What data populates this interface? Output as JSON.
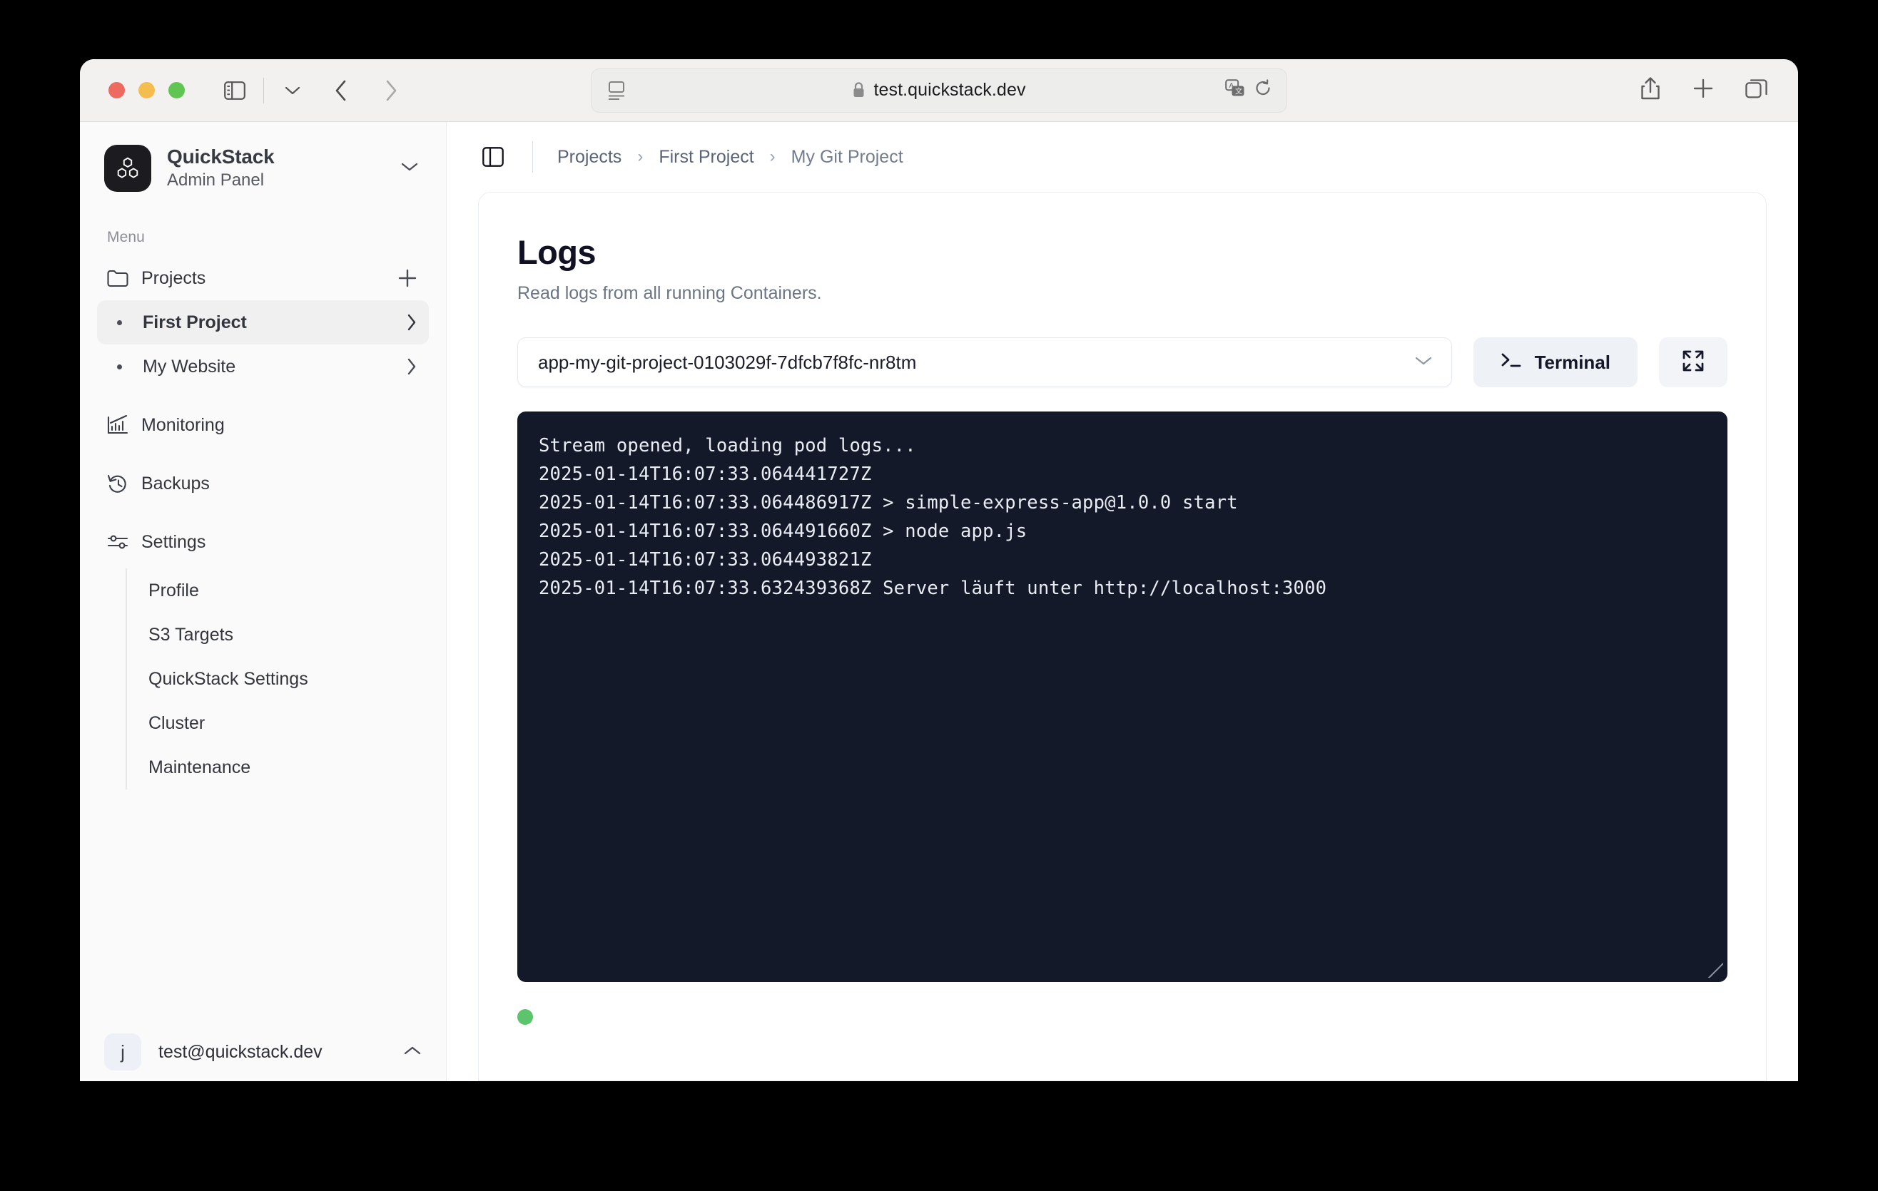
{
  "browser": {
    "url": "test.quickstack.dev",
    "secure_icon": "lock-icon",
    "sidebar_toggle_icon": "sidebar-toggle-icon",
    "tabgroup_chevron_icon": "chevron-down-icon",
    "back_icon": "chevron-left-icon",
    "forward_icon": "chevron-right-icon",
    "reader_icon": "reader-view-icon",
    "translate_icon": "translate-icon",
    "reload_icon": "reload-icon",
    "share_icon": "share-icon",
    "new_tab_icon": "plus-icon",
    "tab_overview_icon": "tab-overview-icon"
  },
  "sidebar": {
    "brand": {
      "name": "QuickStack",
      "subtitle": "Admin Panel",
      "logo_icon": "cubes-icon",
      "chevron_icon": "chevron-down-icon"
    },
    "menu_label": "Menu",
    "projects": {
      "label": "Projects",
      "icon": "folder-icon",
      "add_icon": "plus-icon"
    },
    "project_items": [
      {
        "label": "First Project",
        "active": true,
        "chevron_icon": "chevron-right-icon"
      },
      {
        "label": "My Website",
        "active": false,
        "chevron_icon": "chevron-right-icon"
      }
    ],
    "nav_items": [
      {
        "label": "Monitoring",
        "icon": "chart-line-icon"
      },
      {
        "label": "Backups",
        "icon": "history-icon"
      }
    ],
    "settings": {
      "label": "Settings",
      "icon": "sliders-icon",
      "children": [
        {
          "label": "Profile"
        },
        {
          "label": "S3 Targets"
        },
        {
          "label": "QuickStack Settings"
        },
        {
          "label": "Cluster"
        },
        {
          "label": "Maintenance"
        }
      ]
    },
    "user": {
      "avatar_initial": "j",
      "email": "test@quickstack.dev",
      "chevron_icon": "chevron-up-icon"
    }
  },
  "topbar": {
    "panel_toggle_icon": "panel-toggle-icon",
    "breadcrumbs": [
      {
        "label": "Projects"
      },
      {
        "label": "First Project"
      },
      {
        "label": "My Git Project"
      }
    ],
    "separator": "›"
  },
  "page": {
    "title": "Logs",
    "subtitle": "Read logs from all running Containers.",
    "pod_select": {
      "value": "app-my-git-project-0103029f-7dfcb7f8fc-nr8tm",
      "chevron_icon": "chevron-down-icon"
    },
    "terminal_button": {
      "label": "Terminal",
      "icon": "prompt-icon"
    },
    "fullscreen_button": {
      "icon": "expand-icon"
    },
    "log_lines": [
      "Stream opened, loading pod logs...",
      "2025-01-14T16:07:33.064441727Z",
      "2025-01-14T16:07:33.064486917Z > simple-express-app@1.0.0 start",
      "2025-01-14T16:07:33.064491660Z > node app.js",
      "2025-01-14T16:07:33.064493821Z",
      "2025-01-14T16:07:33.632439368Z Server läuft unter http://localhost:3000"
    ],
    "resize_handle_icon": "resize-handle-icon",
    "status": {
      "name": "connected-status-dot",
      "color": "#5bc46c"
    }
  },
  "colors": {
    "terminal_bg": "#141929",
    "sidebar_bg": "#fafafa",
    "accent": "#eef1f6",
    "status_green": "#5bc46c"
  }
}
